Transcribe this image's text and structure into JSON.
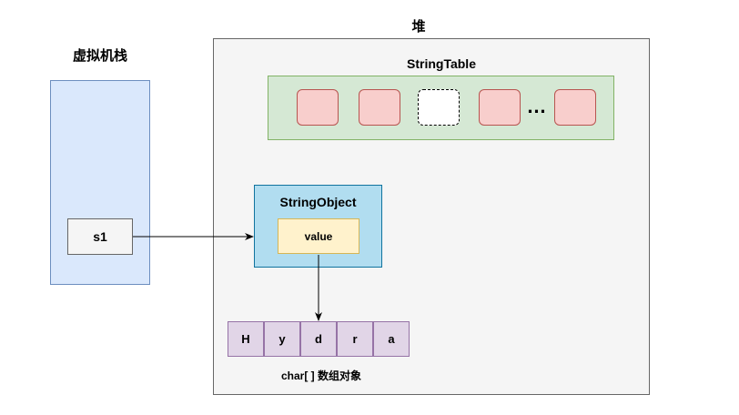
{
  "stack": {
    "title": "虚拟机栈",
    "variable": "s1"
  },
  "heap": {
    "title": "堆"
  },
  "string_table": {
    "title": "StringTable",
    "slots": [
      "filled",
      "filled",
      "empty",
      "filled",
      "filled"
    ],
    "ellipsis": "…"
  },
  "string_object": {
    "title": "StringObject",
    "field": "value"
  },
  "char_array": {
    "chars": [
      "H",
      "y",
      "d",
      "r",
      "a"
    ],
    "caption": "char[ ] 数组对象"
  },
  "colors": {
    "stack_fill": "#dae8fc",
    "heap_fill": "#f5f5f5",
    "table_fill": "#d5e8d4",
    "slot_fill": "#f8cecc",
    "object_fill": "#b1ddf0",
    "field_fill": "#fff2cc",
    "array_fill": "#e1d5e7"
  }
}
